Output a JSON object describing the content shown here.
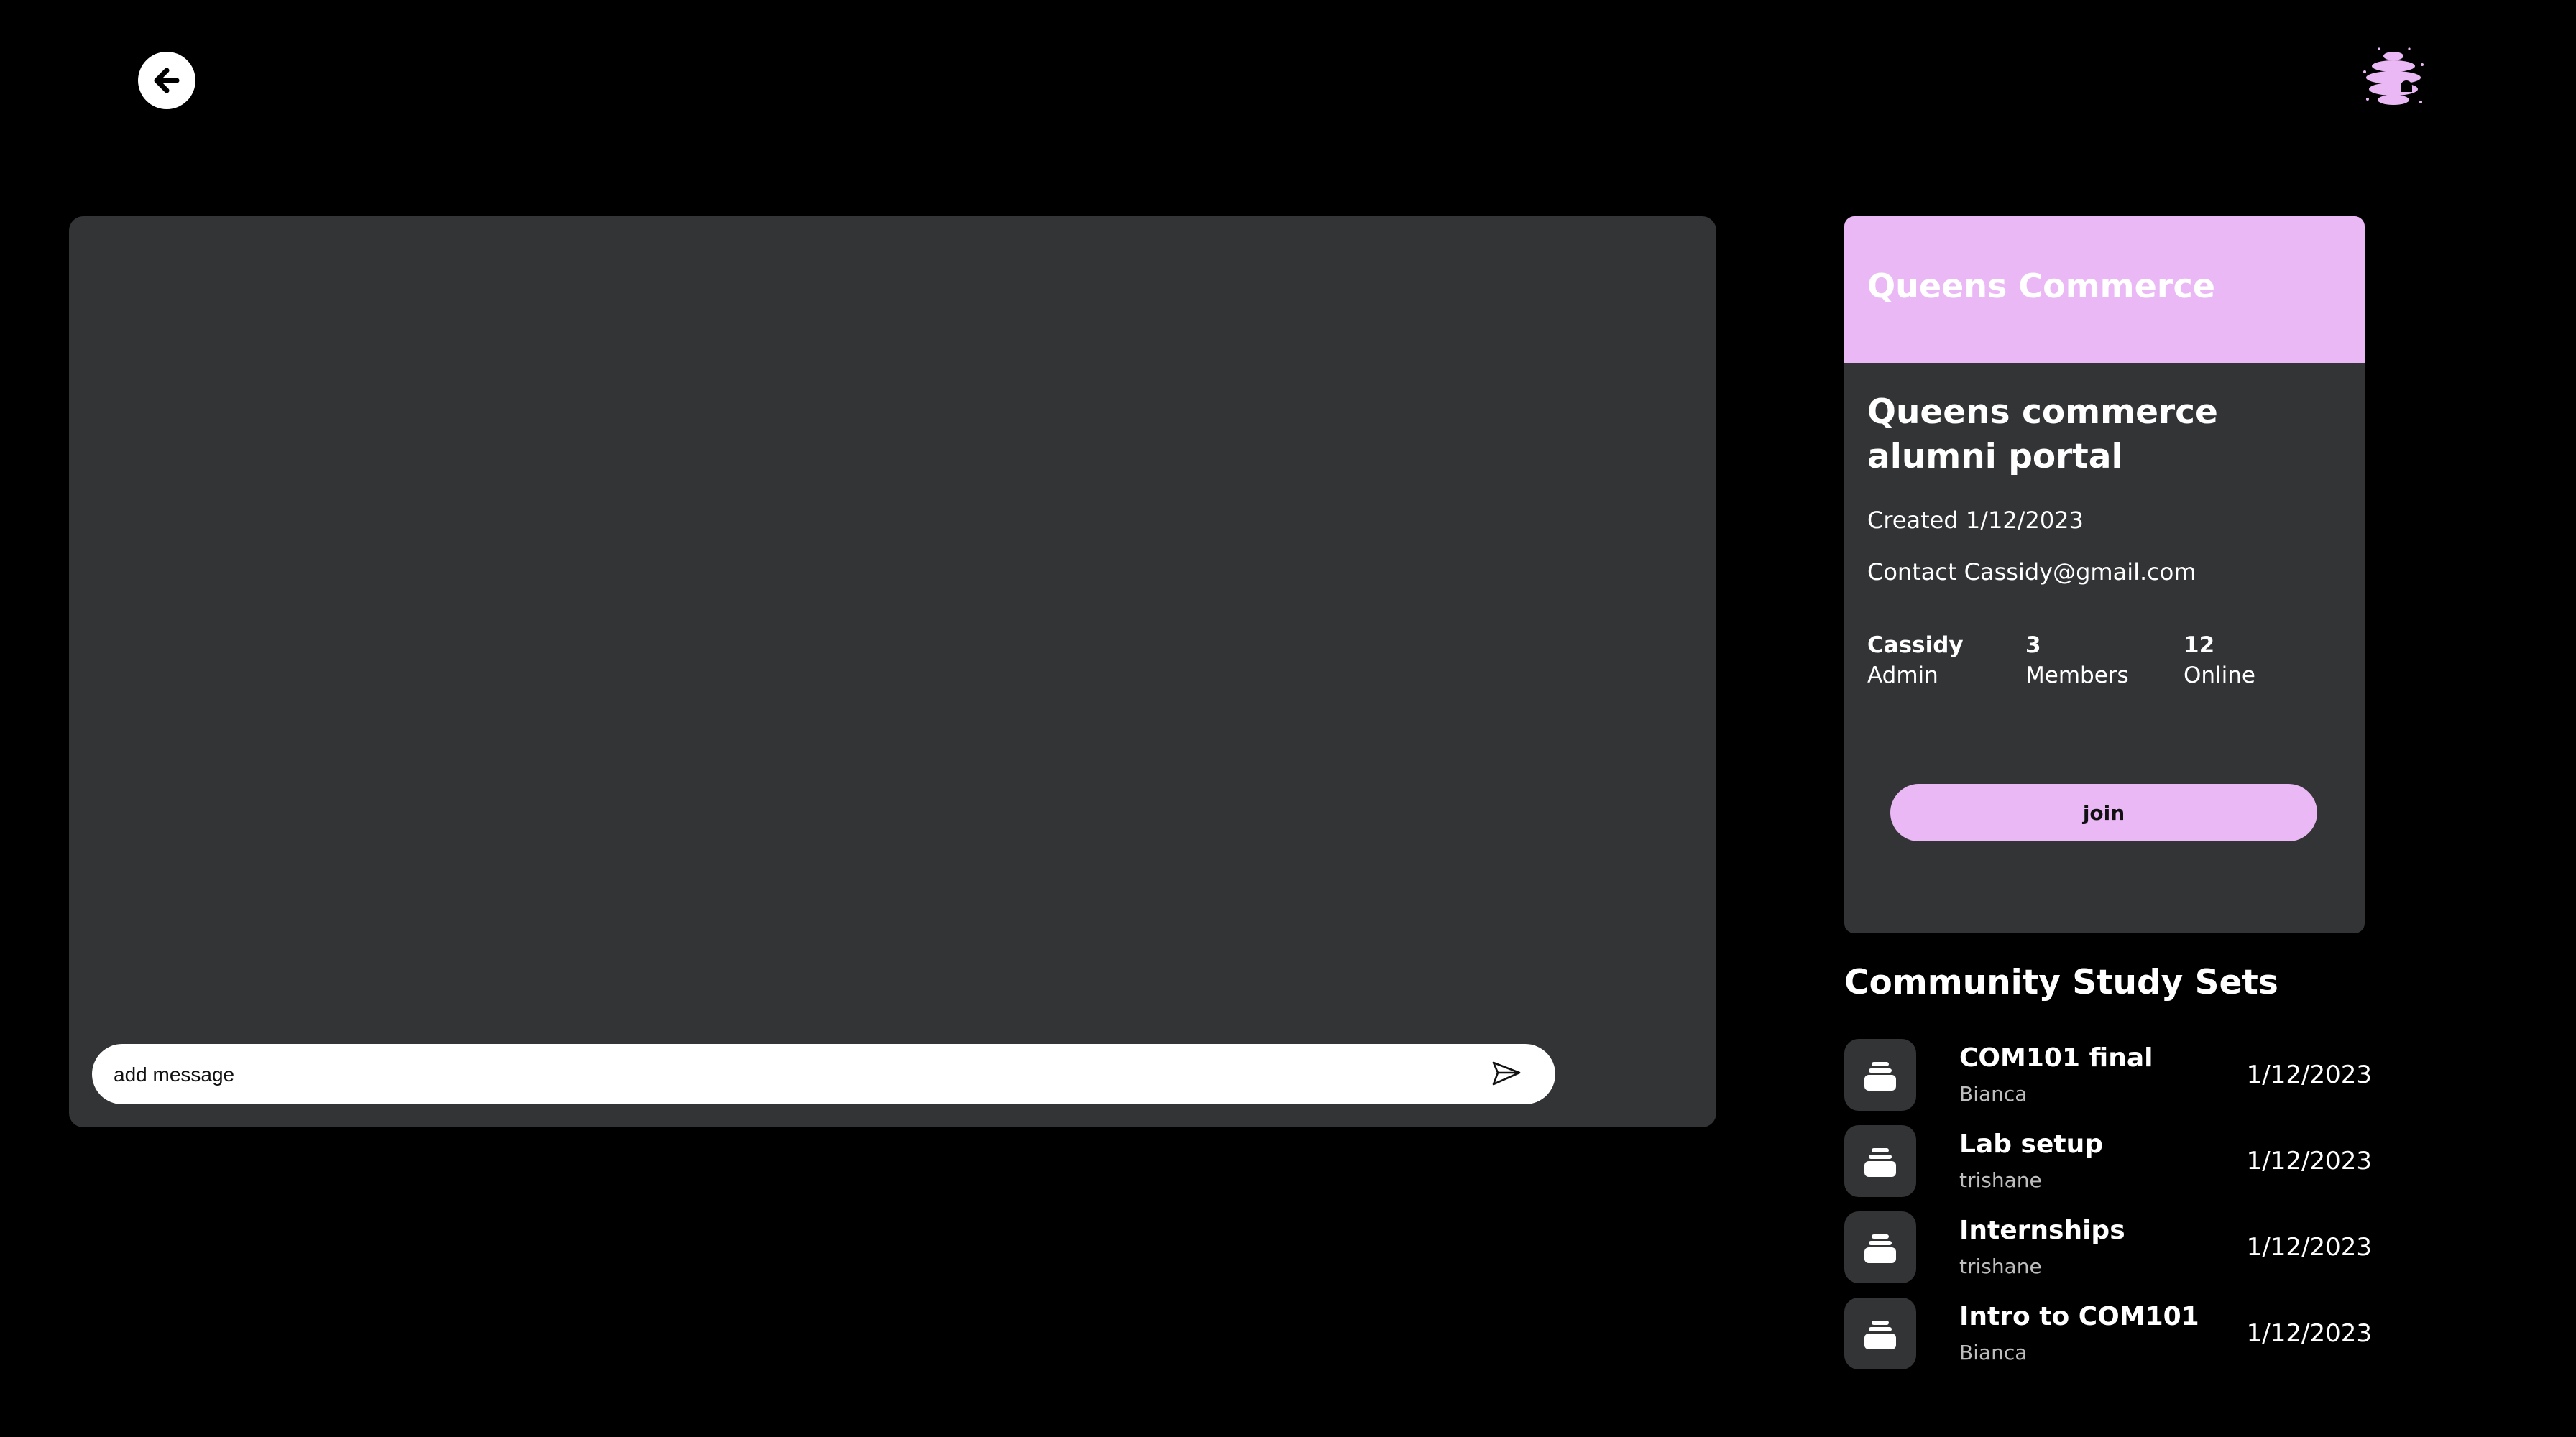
{
  "header": {
    "back_icon": "arrow-left-icon",
    "logo_icon": "beehive-logo-icon"
  },
  "chat": {
    "message_placeholder": "add message",
    "send_icon": "send-icon"
  },
  "community": {
    "banner_title": "Queens Commerce",
    "name": "Queens commerce alumni portal",
    "created": "Created 1/12/2023",
    "contact": "Contact Cassidy@gmail.com",
    "stats": [
      {
        "value": "Cassidy",
        "label": "Admin"
      },
      {
        "value": "3",
        "label": "Members"
      },
      {
        "value": "12",
        "label": "Online"
      }
    ],
    "join_label": "join"
  },
  "study_sets": {
    "heading": "Community Study Sets",
    "items": [
      {
        "name": "COM101 final",
        "author": "Bianca",
        "date": "1/12/2023"
      },
      {
        "name": "Lab setup",
        "author": "trishane",
        "date": "1/12/2023"
      },
      {
        "name": "Internships",
        "author": "trishane",
        "date": "1/12/2023"
      },
      {
        "name": "Intro to COM101",
        "author": "Bianca",
        "date": "1/12/2023"
      }
    ]
  },
  "colors": {
    "accent": "#ebb8f6",
    "panel": "#333436",
    "background": "#000000"
  }
}
